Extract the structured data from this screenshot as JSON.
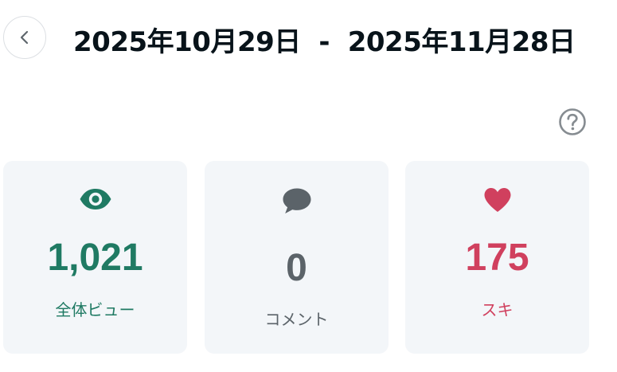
{
  "header": {
    "title": "2025年10月29日  -  2025年11月28日",
    "back_icon": "chevron-left-icon",
    "help_icon": "question-circle-icon"
  },
  "stats": {
    "views": {
      "value": "1,021",
      "label": "全体ビュー",
      "icon": "eye-icon",
      "color": "#1f7a63"
    },
    "comments": {
      "value": "0",
      "label": "コメント",
      "icon": "speech-bubble-icon",
      "color": "#5b6369"
    },
    "likes": {
      "value": "175",
      "label": "スキ",
      "icon": "heart-icon",
      "color": "#d0405e"
    }
  }
}
